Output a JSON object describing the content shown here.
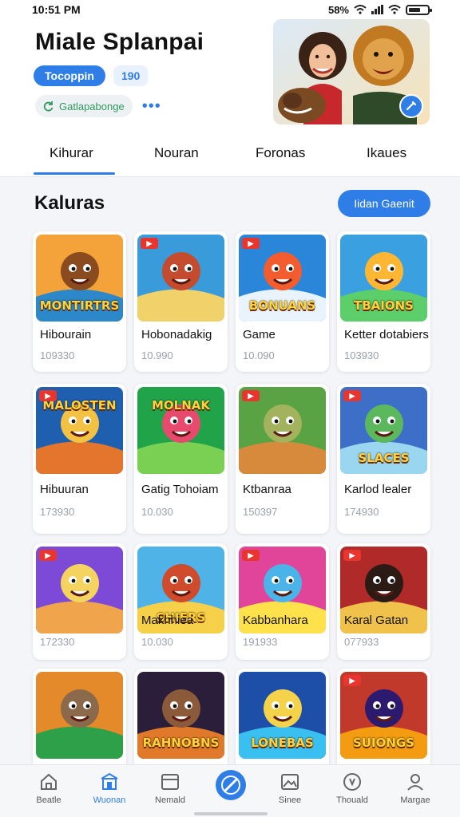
{
  "status_bar": {
    "time": "10:51 PM",
    "right_text": "58%"
  },
  "header": {
    "title": "Miale Splanpai",
    "primary_pill": "Tocoppin",
    "count_pill": "190",
    "chip": "Gatlapabonge"
  },
  "tabs": [
    {
      "label": "Kihurar",
      "active": true
    },
    {
      "label": "Nouran"
    },
    {
      "label": "Foronas"
    },
    {
      "label": "Ikaues"
    }
  ],
  "section": {
    "title": "Kaluras",
    "button": "Iidan Gaenit"
  },
  "games": [
    {
      "title": "Hibourain",
      "count": "109330",
      "art": "MONTIRTRS"
    },
    {
      "title": "Hobonadakig",
      "count": "10.990",
      "art": ""
    },
    {
      "title": "Game",
      "count": "10.090",
      "art": "BONUANS"
    },
    {
      "title": "Ketter dotabiers",
      "count": "103930",
      "art": "TBAIONS"
    },
    {
      "title": "Hibuuran",
      "count": "173930",
      "art": "MALOSTEN"
    },
    {
      "title": "Gatig Tohoiam",
      "count": "10.030",
      "art": "MOLNAK"
    },
    {
      "title": "Ktbanraa",
      "count": "150397",
      "art": ""
    },
    {
      "title": "Karlod lealer",
      "count": "174930",
      "art": "SLACES"
    },
    {
      "title": "",
      "count": "172330",
      "art": ""
    },
    {
      "title": "Makhhiea",
      "count": "10.030",
      "art": "SHIERS"
    },
    {
      "title": "Kabbanhara",
      "count": "191933",
      "art": ""
    },
    {
      "title": "Karal Gatan",
      "count": "077933",
      "art": ""
    },
    {
      "title": "",
      "count": "",
      "art": ""
    },
    {
      "title": "",
      "count": "",
      "art": "RAHNOBNS"
    },
    {
      "title": "",
      "count": "",
      "art": "LONEBAS"
    },
    {
      "title": "",
      "count": "",
      "art": "SUIONGS"
    }
  ],
  "nav": [
    {
      "label": "Beatle",
      "icon": "home-icon"
    },
    {
      "label": "Wuonan",
      "icon": "store-icon",
      "active": true
    },
    {
      "label": "Nemald",
      "icon": "window-icon"
    },
    {
      "label": "",
      "icon": "compass-icon"
    },
    {
      "label": "Sinee",
      "icon": "image-icon"
    },
    {
      "label": "Thouald",
      "icon": "clock-icon"
    },
    {
      "label": "Margae",
      "icon": "profile-icon"
    }
  ],
  "colors": {
    "accent": "#2f7ee8",
    "chip_text": "#2c9a5e",
    "badge": "#e8362f"
  }
}
